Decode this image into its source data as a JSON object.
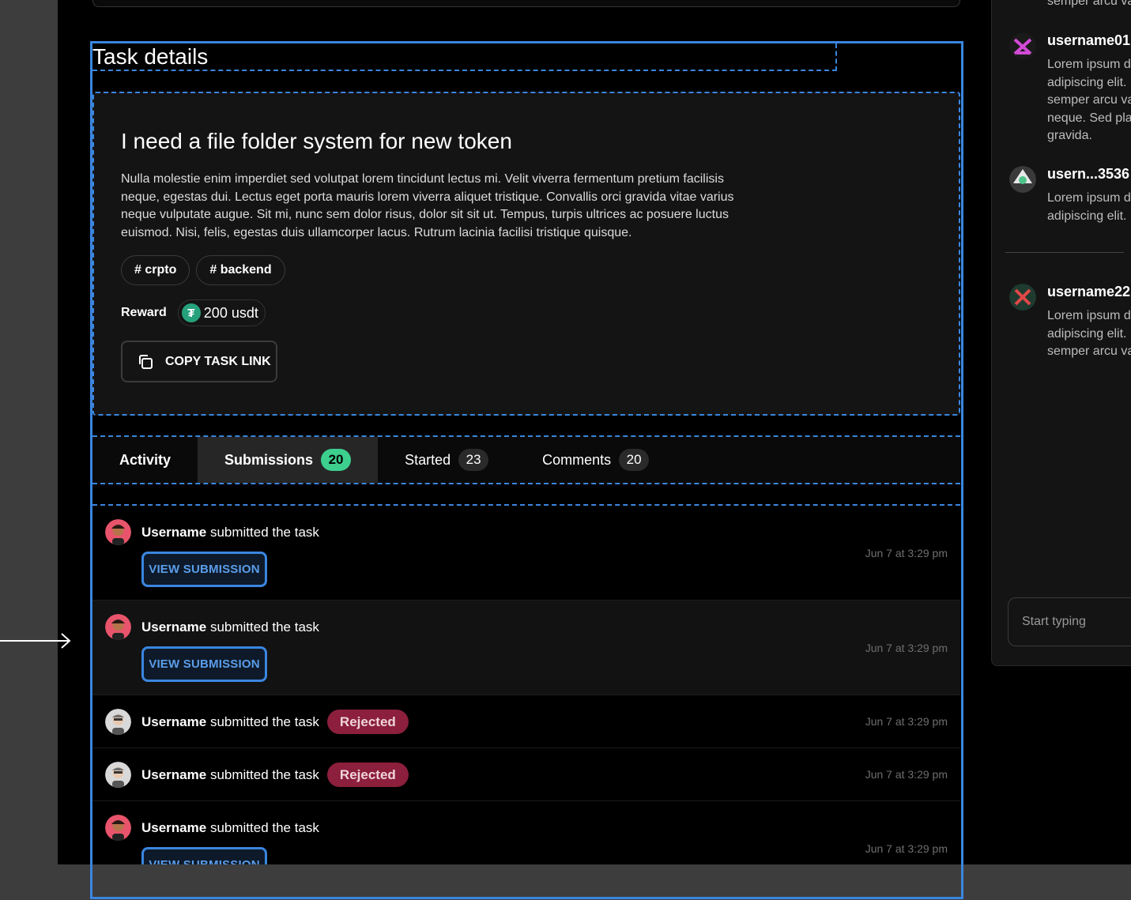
{
  "page_title": "Task details",
  "task": {
    "title": "I need a file folder system for new token",
    "description": "Nulla molestie enim imperdiet sed volutpat lorem tincidunt lectus mi. Velit viverra fermentum pretium facilisis neque, egestas dui. Lectus eget porta mauris lorem viverra aliquet tristique. Convallis orci gravida vitae varius neque vulputate augue. Sit mi, nunc sem dolor risus, dolor sit sit ut. Tempus, turpis ultrices ac posuere luctus euismod. Nisi, felis, egestas duis ullamcorper lacus. Rutrum lacinia facilisi tristique quisque.",
    "tags": [
      "# crpto",
      "# backend"
    ],
    "reward_label": "Reward",
    "reward_value": "200 usdt",
    "reward_icon": "usdt-tether-icon",
    "copy_button": "COPY TASK LINK"
  },
  "tabs": [
    {
      "label": "Activity",
      "count": ""
    },
    {
      "label": "Submissions",
      "count": "20"
    },
    {
      "label": "Started",
      "count": "23"
    },
    {
      "label": "Comments",
      "count": "20"
    }
  ],
  "submissions": [
    {
      "user": "Username",
      "action": "submitted the task",
      "time": "Jun 7 at 3:29 pm",
      "button": "VIEW SUBMISSION",
      "status": ""
    },
    {
      "user": "Username",
      "action": "submitted the task",
      "time": "Jun 7 at 3:29 pm",
      "button": "VIEW SUBMISSION",
      "status": ""
    },
    {
      "user": "Username",
      "action": "submitted the task",
      "time": "Jun 7 at 3:29 pm",
      "button": "",
      "status": "Rejected"
    },
    {
      "user": "Username",
      "action": "submitted the task",
      "time": "Jun 7 at 3:29 pm",
      "button": "",
      "status": "Rejected"
    },
    {
      "user": "Username",
      "action": "submitted the task",
      "time": "Jun 7 at 3:29 pm",
      "button": "VIEW SUBMISSION",
      "status": ""
    }
  ],
  "comments_panel": {
    "top_snippet": "semper arcu va",
    "comments": [
      {
        "name": "username01",
        "lines": [
          "Lorem ipsum d",
          "adipiscing elit.",
          "semper arcu va",
          "neque. Sed pla",
          "gravida."
        ]
      },
      {
        "name": "usern...3536",
        "lines": [
          "Lorem ipsum d",
          "adipiscing elit."
        ]
      },
      {
        "name": "username22",
        "lines": [
          "Lorem ipsum d",
          "adipiscing elit.",
          "semper arcu va"
        ]
      }
    ],
    "input_placeholder": "Start typing"
  },
  "colors": {
    "accent_blue": "#3a86e0",
    "count_green": "#3ccf8e",
    "rejected": "#8b1f3c",
    "usdt": "#26a17b"
  }
}
